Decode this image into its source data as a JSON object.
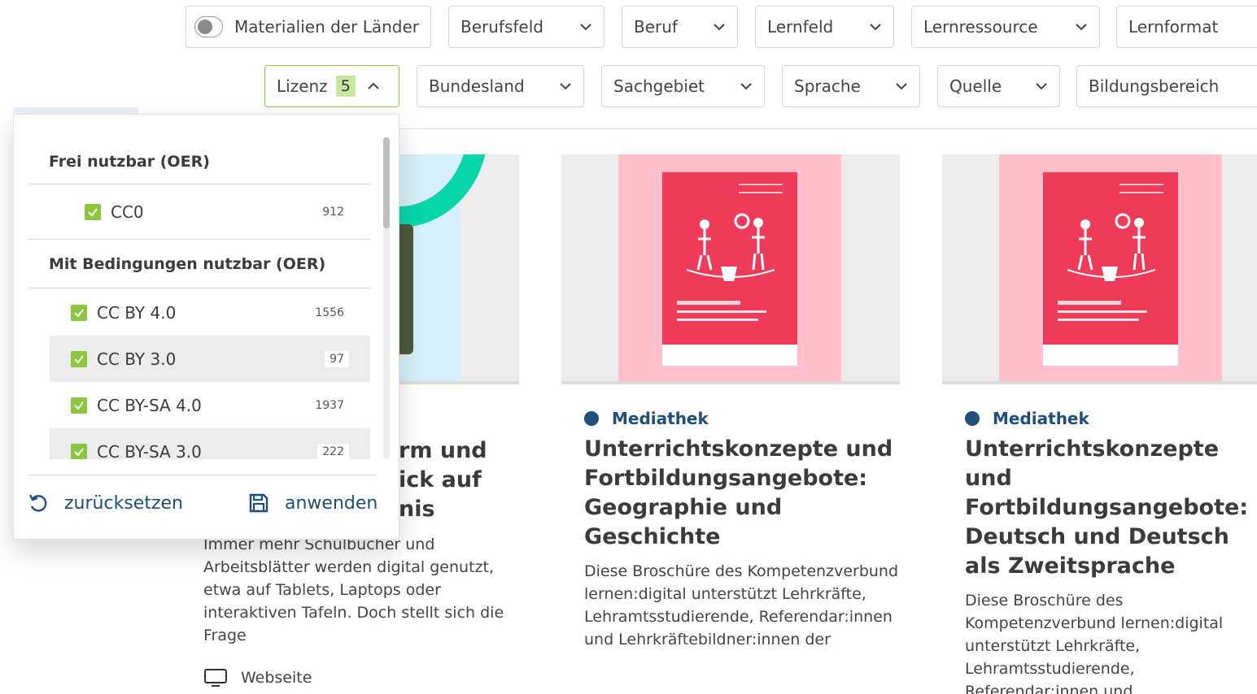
{
  "filters_row1": {
    "toggle_label": "Materialien der Länder",
    "toggle_on": false,
    "dropdowns": [
      "Berufsfeld",
      "Beruf",
      "Lernfeld",
      "Lernressource",
      "Lernformat"
    ]
  },
  "filters_row2": {
    "active": {
      "label": "Lizenz",
      "count": "5"
    },
    "dropdowns": [
      "Bundesland",
      "Sachgebiet",
      "Sprache",
      "Quelle",
      "Bildungsbereich"
    ]
  },
  "license_panel": {
    "groups": [
      {
        "title": "Frei nutzbar (OER)"
      },
      {
        "title": "Mit Bedingungen nutzbar (OER)"
      }
    ],
    "options": [
      {
        "name": "CC0",
        "count": "912",
        "checked": true
      },
      {
        "name": "CC BY 4.0",
        "count": "1556",
        "checked": true
      },
      {
        "name": "CC BY 3.0",
        "count": "97",
        "checked": true
      },
      {
        "name": "CC BY-SA 4.0",
        "count": "1937",
        "checked": true
      },
      {
        "name": "CC BY-SA 3.0",
        "count": "222",
        "checked": true
      }
    ],
    "reset_label": "zurücksetzen",
    "apply_label": "anwenden"
  },
  "left_card": {
    "title_fragments": [
      "rm und",
      "ick auf",
      "nis"
    ],
    "description": "Immer mehr Schulbücher und Arbeitsblätter werden digital genutzt, etwa auf Tablets, Laptops oder interaktiven Tafeln. Doch stellt sich die Frage",
    "type_label": "Webseite"
  },
  "cards": [
    {
      "source": "Mediathek",
      "title": "Unterrichtskonzepte und Fortbildungsangebote: Geographie und Geschichte",
      "description": "Diese Broschüre des Kompetenzverbund lernen:digital unterstützt Lehrkräfte, Lehramtsstudierende, Referendar:innen und Lehrkräftebildner:innen der"
    },
    {
      "source": "Mediathek",
      "title": "Unterrichtskonzepte und Fortbildungsangebote: Deutsch und Deutsch als Zweitsprache",
      "description": "Diese Broschüre des Kompetenzverbund lernen:digital unterstützt Lehrkräfte, Lehramtsstudierende, Referendar:innen und Lehrkräftebildner:innen der"
    }
  ],
  "colors": {
    "accent_green": "#8cc63f",
    "brand_blue": "#1e4e79",
    "brochure_red": "#ef3b5a"
  }
}
